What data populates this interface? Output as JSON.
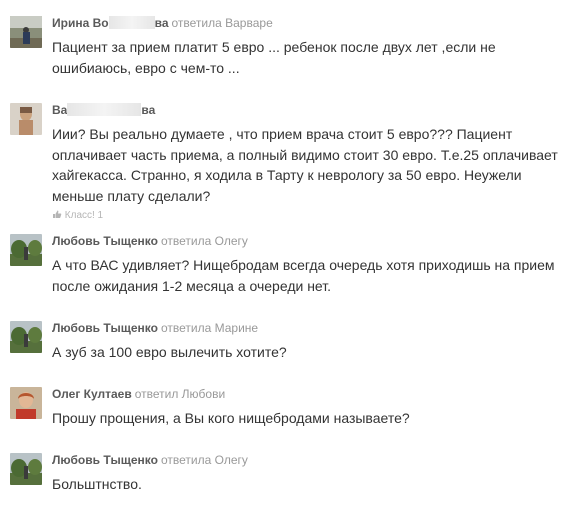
{
  "comments": [
    {
      "author_prefix": "Ирина Во",
      "author_suffix": "ва",
      "reply_to": "ответила Варваре",
      "text": "Пациент за прием платит 5 евро ... ребенок после двух лет ,если не ошибиаюсь, евро с чем-то ..."
    },
    {
      "author_prefix": "Ва",
      "author_suffix": "ва",
      "reply_to": "",
      "text": "Иии? Вы реально думаете , что прием врача стоит 5 евро??? Пациент оплачивает часть приема, а полный видимо стоит 30 евро. Т.е.25 оплачивает хайгекасса. Странно, я ходила в Тарту к неврологу за 50 евро. Неужели меньше плату сделали?",
      "like_label": "Класс! 1"
    },
    {
      "author": "Любовь Тыщенко",
      "reply_to": "ответила Олегу",
      "text": "А что ВАС удивляет? Нищебродам всегда очередь хотя приходишь на прием после ожидания 1-2 месяца а очереди нет."
    },
    {
      "author": "Любовь Тыщенко",
      "reply_to": "ответила Марине",
      "text": "А зуб за 100 евро вылечить хотите?"
    },
    {
      "author": "Олег Култаев",
      "reply_to": "ответил Любови",
      "text": "Прошу прощения, а Вы кого нищебродами называете?"
    },
    {
      "author": "Любовь Тыщенко",
      "reply_to": "ответила Олегу",
      "text": "Больштнство."
    }
  ]
}
